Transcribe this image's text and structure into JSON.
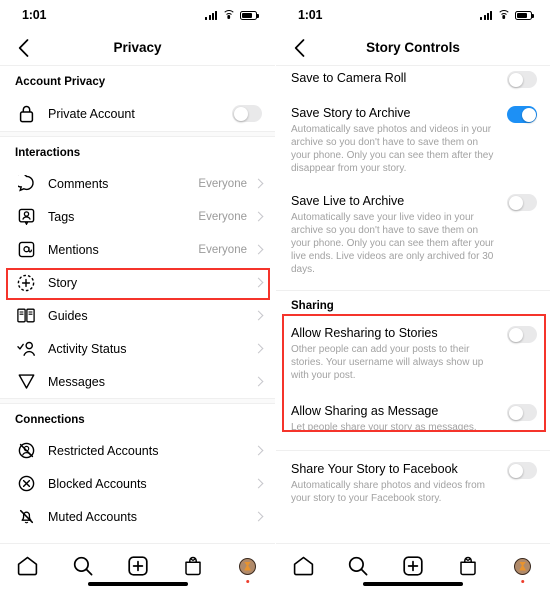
{
  "status_bar": {
    "time": "1:01",
    "signal_icon": "cellular-signal-icon",
    "wifi_icon": "wifi-icon",
    "battery_icon": "battery-icon"
  },
  "left_screen": {
    "nav": {
      "back_icon": "chevron-left-icon",
      "title": "Privacy"
    },
    "sections": [
      {
        "heading": "Account Privacy",
        "rows": [
          {
            "icon": "lock-icon",
            "label": "Private Account",
            "kind": "toggle",
            "toggle_on": false
          }
        ]
      },
      {
        "heading": "Interactions",
        "rows": [
          {
            "icon": "comment-icon",
            "label": "Comments",
            "kind": "link",
            "value": "Everyone"
          },
          {
            "icon": "tag-icon",
            "label": "Tags",
            "kind": "link",
            "value": "Everyone"
          },
          {
            "icon": "mention-icon",
            "label": "Mentions",
            "kind": "link",
            "value": "Everyone"
          },
          {
            "icon": "story-icon",
            "label": "Story",
            "kind": "link",
            "value": "",
            "highlighted": true
          },
          {
            "icon": "guides-icon",
            "label": "Guides",
            "kind": "link",
            "value": ""
          },
          {
            "icon": "activity-status-icon",
            "label": "Activity Status",
            "kind": "link",
            "value": ""
          },
          {
            "icon": "messages-icon",
            "label": "Messages",
            "kind": "link",
            "value": ""
          }
        ]
      },
      {
        "heading": "Connections",
        "rows": [
          {
            "icon": "restricted-icon",
            "label": "Restricted Accounts",
            "kind": "link",
            "value": ""
          },
          {
            "icon": "blocked-icon",
            "label": "Blocked Accounts",
            "kind": "link",
            "value": ""
          },
          {
            "icon": "muted-icon",
            "label": "Muted Accounts",
            "kind": "link",
            "value": ""
          }
        ]
      }
    ]
  },
  "right_screen": {
    "nav": {
      "back_icon": "chevron-left-icon",
      "title": "Story Controls"
    },
    "settings": [
      {
        "title": "Save to Camera Roll",
        "desc": "",
        "toggle_on": false
      },
      {
        "title": "Save Story to Archive",
        "desc": "Automatically save photos and videos in your archive so you don't have to save them on your phone. Only you can see them after they disappear from your story.",
        "toggle_on": true
      },
      {
        "title": "Save Live to Archive",
        "desc": "Automatically save your live video in your archive so you don't have to save them on your phone. Only you can see them after your live ends. Live videos are only archived for 30 days.",
        "toggle_on": false
      }
    ],
    "sharing_heading": "Sharing",
    "sharing_settings": [
      {
        "title": "Allow Resharing to Stories",
        "desc": "Other people can add your posts to their stories. Your username will always show up with your post.",
        "toggle_on": false
      },
      {
        "title": "Allow Sharing as Message",
        "desc": "Let people share your story as messages.",
        "toggle_on": false
      }
    ],
    "facebook_setting": {
      "title": "Share Your Story to Facebook",
      "desc": "Automatically share photos and videos from your story to your Facebook story.",
      "toggle_on": false
    }
  },
  "tab_bar": {
    "tabs": [
      {
        "icon": "home-icon",
        "name": "home-tab"
      },
      {
        "icon": "search-icon",
        "name": "search-tab"
      },
      {
        "icon": "add-post-icon",
        "name": "add-post-tab"
      },
      {
        "icon": "shop-icon",
        "name": "shop-tab"
      },
      {
        "icon": "profile-avatar-icon",
        "name": "profile-tab",
        "badge": true
      }
    ]
  },
  "colors": {
    "accent_blue": "#1d90f5",
    "highlight_red": "#f5342b",
    "muted_text": "#a2a2a2",
    "divider": "#efefef"
  }
}
